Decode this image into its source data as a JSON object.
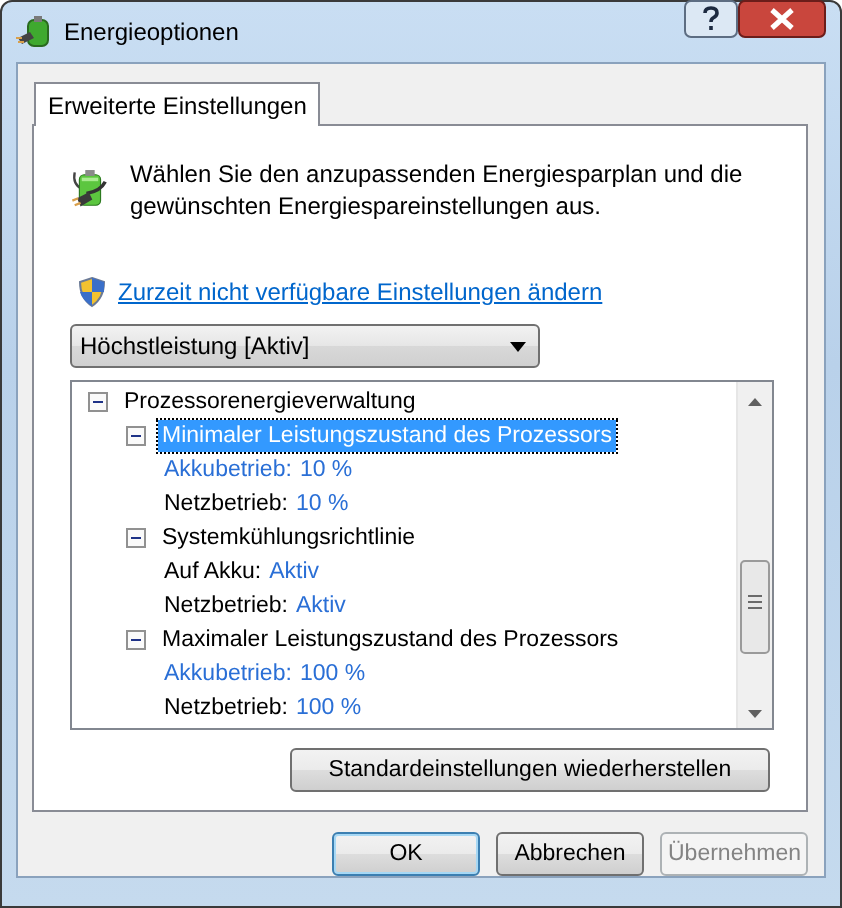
{
  "window": {
    "title": "Energieoptionen"
  },
  "tabs": [
    {
      "label": "Erweiterte Einstellungen",
      "selected": true
    }
  ],
  "intro": "Wählen Sie den anzupassenden Energiesparplan und die gewünschten Energiespareinstellungen aus.",
  "admin_link": "Zurzeit nicht verfügbare Einstellungen ändern",
  "plan_dropdown": {
    "value": "Höchstleistung [Aktiv]"
  },
  "tree": [
    {
      "kind": "group",
      "label": "Prozessorenergieverwaltung",
      "expanded": true,
      "selected": false,
      "children": [
        {
          "kind": "group",
          "label": "Minimaler Leistungszustand des Prozessors",
          "expanded": true,
          "selected": true,
          "children": [
            {
              "kind": "value",
              "label": "Akkubetrieb:",
              "value": "10 %",
              "link": true
            },
            {
              "kind": "value",
              "label": "Netzbetrieb:",
              "value": "10 %",
              "link": false
            }
          ]
        },
        {
          "kind": "group",
          "label": "Systemkühlungsrichtlinie",
          "expanded": true,
          "selected": false,
          "children": [
            {
              "kind": "value",
              "label": "Auf Akku:",
              "value": "Aktiv",
              "link": false
            },
            {
              "kind": "value",
              "label": "Netzbetrieb:",
              "value": "Aktiv",
              "link": false
            }
          ]
        },
        {
          "kind": "group",
          "label": "Maximaler Leistungszustand des Prozessors",
          "expanded": true,
          "selected": false,
          "children": [
            {
              "kind": "value",
              "label": "Akkubetrieb:",
              "value": "100 %",
              "link": true
            },
            {
              "kind": "value",
              "label": "Netzbetrieb:",
              "value": "100 %",
              "link": false
            }
          ]
        }
      ]
    }
  ],
  "restore_button": "Standardeinstellungen wiederherstellen",
  "buttons": [
    {
      "label": "OK",
      "default": true,
      "disabled": false
    },
    {
      "label": "Abbrechen",
      "default": false,
      "disabled": false
    },
    {
      "label": "Übernehmen",
      "default": false,
      "disabled": true
    }
  ]
}
